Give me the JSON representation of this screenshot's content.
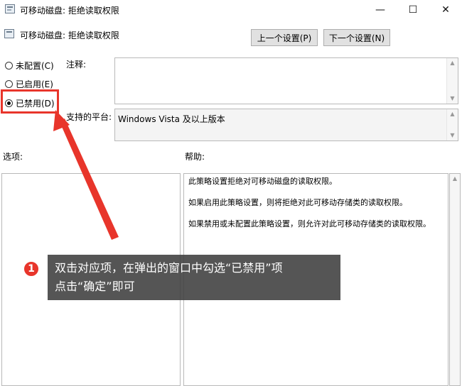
{
  "window": {
    "title": "可移动磁盘: 拒绝读取权限",
    "minimize": "—",
    "maximize": "☐",
    "close": "✕"
  },
  "policy": {
    "title": "可移动磁盘: 拒绝读取权限",
    "prev_button": "上一个设置(P)",
    "next_button": "下一个设置(N)"
  },
  "radios": [
    {
      "label": "未配置(C)",
      "checked": false
    },
    {
      "label": "已启用(E)",
      "checked": false
    },
    {
      "label": "已禁用(D)",
      "checked": true
    }
  ],
  "comment_label": "注释:",
  "platform_label": "支持的平台:",
  "platform_value": "Windows Vista 及以上版本",
  "options_label": "选项:",
  "help_label": "帮助:",
  "help_paragraphs": [
    "此策略设置拒绝对可移动磁盘的读取权限。",
    "如果启用此策略设置，则将拒绝对此可移动存储类的读取权限。",
    "如果禁用或未配置此策略设置，则允许对此可移动存储类的读取权限。"
  ],
  "annotation": {
    "number": "1",
    "line1": "双击对应项，在弹出的窗口中勾选“已禁用”项",
    "line2": "点击“确定”即可",
    "accent_color": "#e8352b"
  }
}
